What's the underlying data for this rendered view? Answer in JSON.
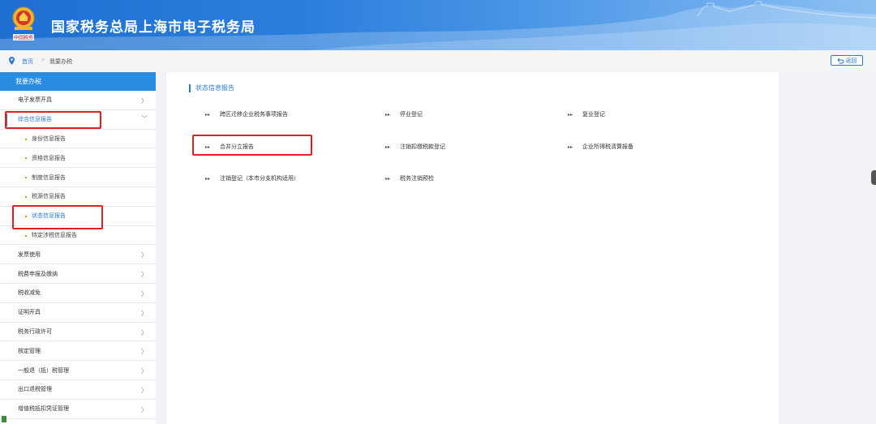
{
  "header": {
    "title": "国家税务总局上海市电子税务局",
    "logo_caption": "中国税务"
  },
  "breadcrumb": {
    "home": "首页",
    "separator": ">",
    "current": "我要办税",
    "back_label": "返回"
  },
  "sidebar": {
    "title": "我要办税",
    "items": [
      {
        "label": "电子发票开具",
        "arrow": "〉"
      },
      {
        "label": "综合信息报告",
        "arrow": "﹀"
      },
      {
        "label": "身份信息报告"
      },
      {
        "label": "资格信息报告"
      },
      {
        "label": "制度信息报告"
      },
      {
        "label": "税源信息报告"
      },
      {
        "label": "状态信息报告"
      },
      {
        "label": "特定涉税信息报告"
      },
      {
        "label": "发票使用",
        "arrow": "〉"
      },
      {
        "label": "税费申报及缴纳",
        "arrow": "〉"
      },
      {
        "label": "税收减免",
        "arrow": "〉"
      },
      {
        "label": "证明开具",
        "arrow": "〉"
      },
      {
        "label": "税务行政许可",
        "arrow": "〉"
      },
      {
        "label": "核定管理",
        "arrow": "〉"
      },
      {
        "label": "一般退（抵）税管理",
        "arrow": "〉"
      },
      {
        "label": "出口退税管理",
        "arrow": "〉"
      },
      {
        "label": "增值税抵扣凭证管理",
        "arrow": "〉"
      }
    ]
  },
  "main": {
    "section_title": "状态信息报告",
    "bullet": "▸▸",
    "links": [
      "跨区迁移企业税务事项报告",
      "停业登记",
      "复业登记",
      "合并分立报告",
      "注销扣缴税款登记",
      "企业所得税清算报备",
      "注销登记（本市分支机构适用）",
      "税务注销预检"
    ]
  },
  "colors": {
    "accent": "#2a7ad6",
    "header_blue": "#1e6fd0",
    "sidebar_head": "#2a8ce0",
    "annotation_red": "#e02020"
  }
}
